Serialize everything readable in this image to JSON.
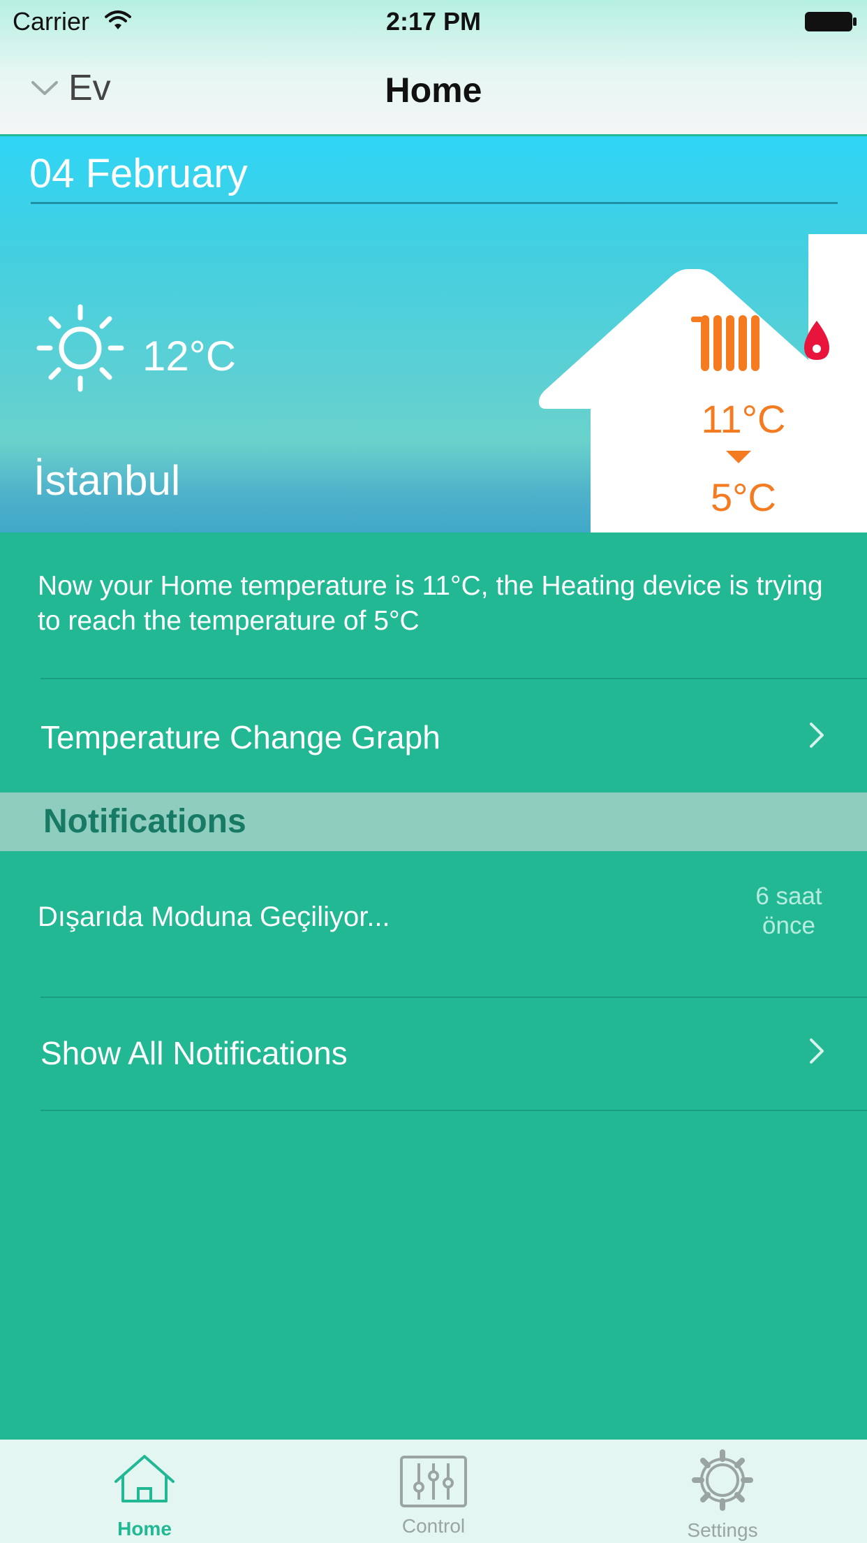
{
  "status_bar": {
    "carrier": "Carrier",
    "time": "2:17 PM"
  },
  "nav": {
    "home_selector": "Ev",
    "title": "Home"
  },
  "weather": {
    "date": "04 February",
    "outdoor_temp": "12°C",
    "city": "İstanbul",
    "icon": "sun-icon"
  },
  "thermostat": {
    "indoor_temp": "11°C",
    "target_temp": "5°C",
    "device_icon": "radiator-icon",
    "status_icon": "flame-icon"
  },
  "info_text": "Now your Home temperature is 11°C, the Heating device is trying to reach the temperature of 5°C",
  "graph_link": "Temperature Change Graph",
  "notifications": {
    "header": "Notifications",
    "items": [
      {
        "title": "Dışarıda Moduna Geçiliyor...",
        "time_line1": "6 saat",
        "time_line2": "önce"
      }
    ],
    "show_all": "Show All Notifications"
  },
  "tabs": [
    {
      "label": "Home",
      "icon": "house-icon",
      "active": true
    },
    {
      "label": "Control",
      "icon": "sliders-icon",
      "active": false
    },
    {
      "label": "Settings",
      "icon": "gear-icon",
      "active": false
    }
  ],
  "colors": {
    "accent": "#21b893",
    "header_blue": "#2fd5f6",
    "orange": "#f47b20",
    "flame_red": "#e8143c",
    "section_header": "#8fcdbf"
  }
}
